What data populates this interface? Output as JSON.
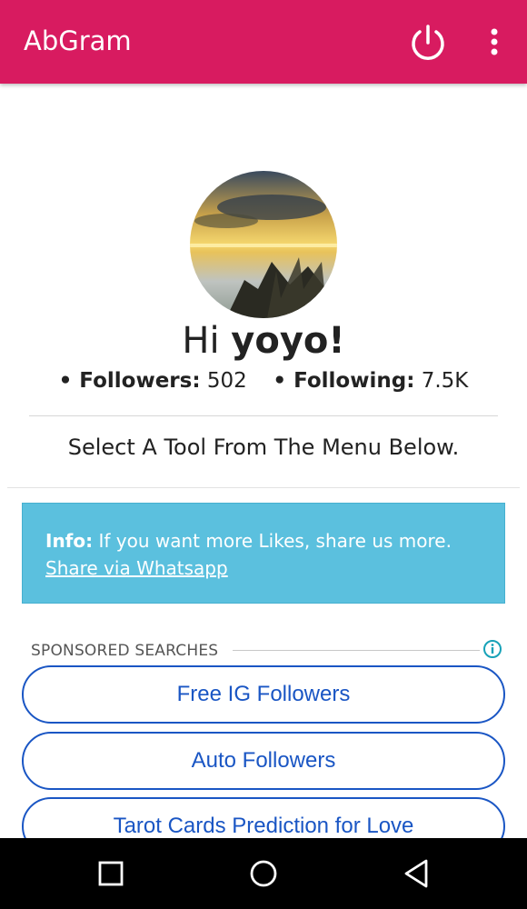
{
  "app": {
    "title": "AbGram"
  },
  "profile": {
    "greeting_prefix": "Hi ",
    "username": "yoyo!",
    "followers_label": "• Followers:",
    "followers_value": "502",
    "following_label": "• Following:",
    "following_value": "7.5K"
  },
  "instruction": "Select A Tool From The Menu Below.",
  "info": {
    "label": "Info:",
    "text": "If you want more Likes, share us more.",
    "link": "Share via Whatsapp",
    "color": "#5bc0de"
  },
  "sponsored": {
    "label": "SPONSORED SEARCHES",
    "items": [
      "Free IG Followers",
      "Auto Followers",
      "Tarot Cards Prediction for Love"
    ]
  },
  "icons": {
    "power": "power-icon",
    "more": "more-vertical-icon",
    "info": "info-circle-icon",
    "back": "nav-back-icon",
    "home": "nav-home-icon",
    "recents": "nav-recents-icon"
  },
  "colors": {
    "app_bar": "#d81b60",
    "pill_accent": "#1a56c4"
  }
}
